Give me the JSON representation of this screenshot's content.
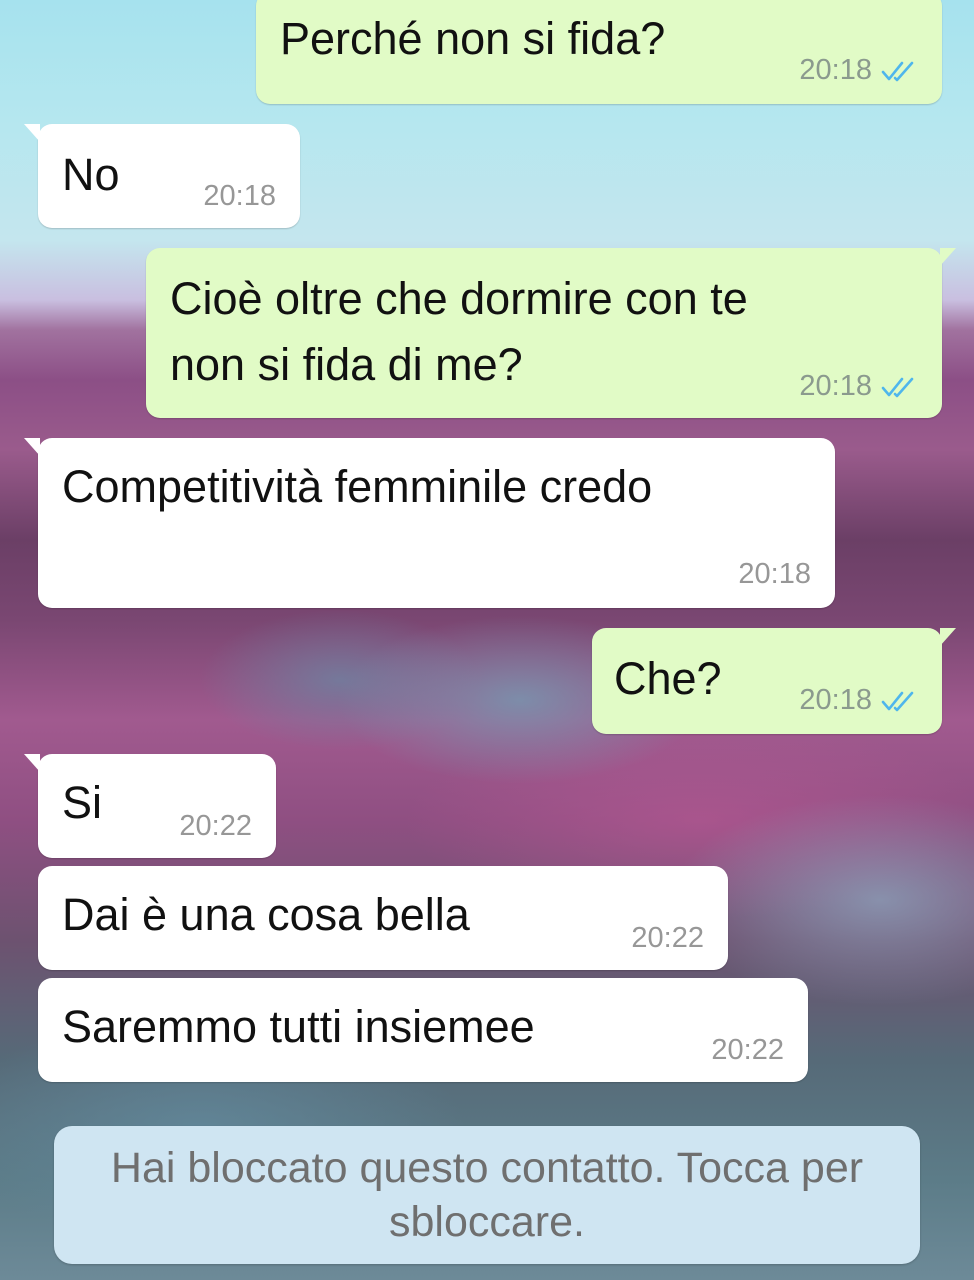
{
  "messages": [
    {
      "text": "Perché non si fida?",
      "time": "20:18",
      "status": "read"
    },
    {
      "text": "No",
      "time": "20:18"
    },
    {
      "text_line1": "Cioè oltre che dormire con te",
      "text_line2": "non si fida di me?",
      "time": "20:18",
      "status": "read"
    },
    {
      "text": "Competitività femminile credo",
      "time": "20:18"
    },
    {
      "text": "Che?",
      "time": "20:18",
      "status": "read"
    },
    {
      "text": "Si",
      "time": "20:22"
    },
    {
      "text": "Dai è una cosa bella",
      "time": "20:22"
    },
    {
      "text": "Saremmo tutti insiemee",
      "time": "20:22"
    }
  ],
  "blocked_banner": {
    "text": "Hai bloccato questo contatto. Tocca per sbloccare."
  },
  "colors": {
    "outgoing": "#e1fbc6",
    "incoming": "#ffffff",
    "read_ticks": "#4fb6ec",
    "banner": "#cfe5f2"
  },
  "icons": {
    "read_receipt": "double-check-icon"
  }
}
